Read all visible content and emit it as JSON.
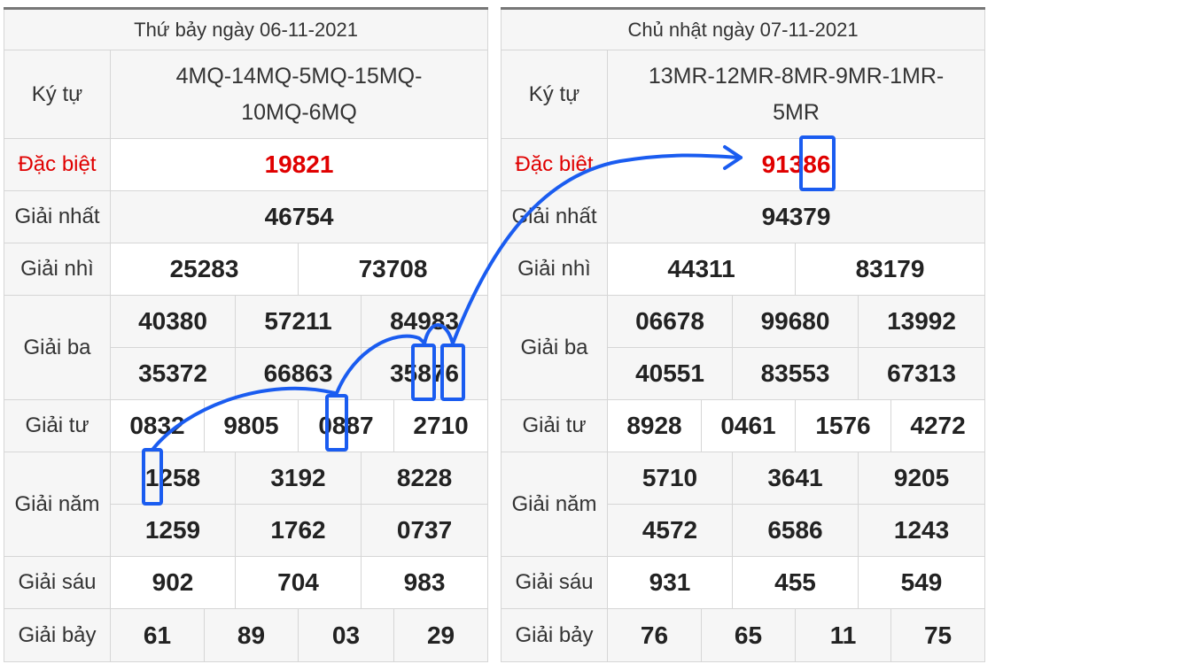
{
  "left": {
    "header": "Thứ bảy ngày 06-11-2021",
    "code_label": "Ký tự",
    "code": "4MQ-14MQ-5MQ-15MQ-10MQ-6MQ",
    "special_label": "Đặc biệt",
    "special": "19821",
    "first_label": "Giải nhất",
    "first": "46754",
    "second_label": "Giải nhì",
    "second": [
      "25283",
      "73708"
    ],
    "third_label": "Giải ba",
    "third": [
      "40380",
      "57211",
      "84983",
      "35372",
      "66863",
      "35876"
    ],
    "fourth_label": "Giải tư",
    "fourth": [
      "0832",
      "9805",
      "0887",
      "2710"
    ],
    "fifth_label": "Giải năm",
    "fifth": [
      "1258",
      "3192",
      "8228",
      "1259",
      "1762",
      "0737"
    ],
    "sixth_label": "Giải sáu",
    "sixth": [
      "902",
      "704",
      "983"
    ],
    "seventh_label": "Giải bảy",
    "seventh": [
      "61",
      "89",
      "03",
      "29"
    ]
  },
  "right": {
    "header": "Chủ nhật ngày 07-11-2021",
    "code_label": "Ký tự",
    "code": "13MR-12MR-8MR-9MR-1MR-5MR",
    "special_label": "Đặc biệt",
    "special": "91386",
    "first_label": "Giải nhất",
    "first": "94379",
    "second_label": "Giải nhì",
    "second": [
      "44311",
      "83179"
    ],
    "third_label": "Giải ba",
    "third": [
      "06678",
      "99680",
      "13992",
      "40551",
      "83553",
      "67313"
    ],
    "fourth_label": "Giải tư",
    "fourth": [
      "8928",
      "0461",
      "1576",
      "4272"
    ],
    "fifth_label": "Giải năm",
    "fifth": [
      "5710",
      "3641",
      "9205",
      "4572",
      "6586",
      "1243"
    ],
    "sixth_label": "Giải sáu",
    "sixth": [
      "931",
      "455",
      "549"
    ],
    "seventh_label": "Giải bảy",
    "seventh": [
      "76",
      "65",
      "11",
      "75"
    ]
  },
  "colors": {
    "special": "#e00000",
    "annotation": "#1a5cf0",
    "label_bg": "#f6f6f6",
    "border": "#d6d6d6"
  }
}
